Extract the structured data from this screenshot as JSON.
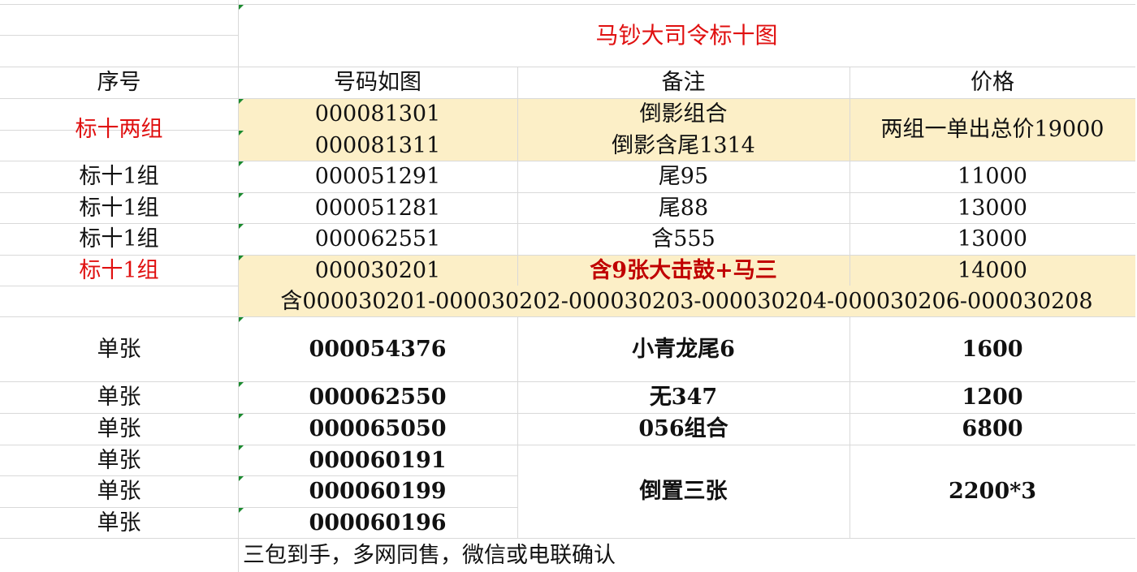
{
  "title": "马钞大司令标十图",
  "headers": {
    "seq": "序号",
    "number": "号码如图",
    "note": "备注",
    "price": "价格"
  },
  "rows": [
    {
      "seq": "标十两组",
      "number": "000081301",
      "note": "倒影组合",
      "price": "两组一单出总价19000"
    },
    {
      "number": "000081311",
      "note": "倒影含尾1314"
    },
    {
      "seq": "标十1组",
      "number": "000051291",
      "note": "尾95",
      "price": "11000"
    },
    {
      "seq": "标十1组",
      "number": "000051281",
      "note": "尾88",
      "price": "13000"
    },
    {
      "seq": "标十1组",
      "number": "000062551",
      "note": "含555",
      "price": "13000"
    },
    {
      "seq": "标十1组",
      "number": "000030201",
      "note": "含9张大击鼓+马三",
      "price": "14000"
    },
    {
      "span": "含000030201-000030202-000030203-000030204-000030206-000030208"
    },
    {
      "seq": "单张",
      "number": "000054376",
      "note": "小青龙尾6",
      "price": "1600"
    },
    {
      "seq": "单张",
      "number": "000062550",
      "note": "无347",
      "price": "1200"
    },
    {
      "seq": "单张",
      "number": "000065050",
      "note": "056组合",
      "price": "6800"
    },
    {
      "seq": "单张",
      "number": "000060191"
    },
    {
      "seq": "单张",
      "number": "000060199",
      "note": "倒置三张",
      "price": "2200*3"
    },
    {
      "seq": "单张",
      "number": "000060196"
    }
  ],
  "footer": "三包到手，多网同售，微信或电联确认"
}
